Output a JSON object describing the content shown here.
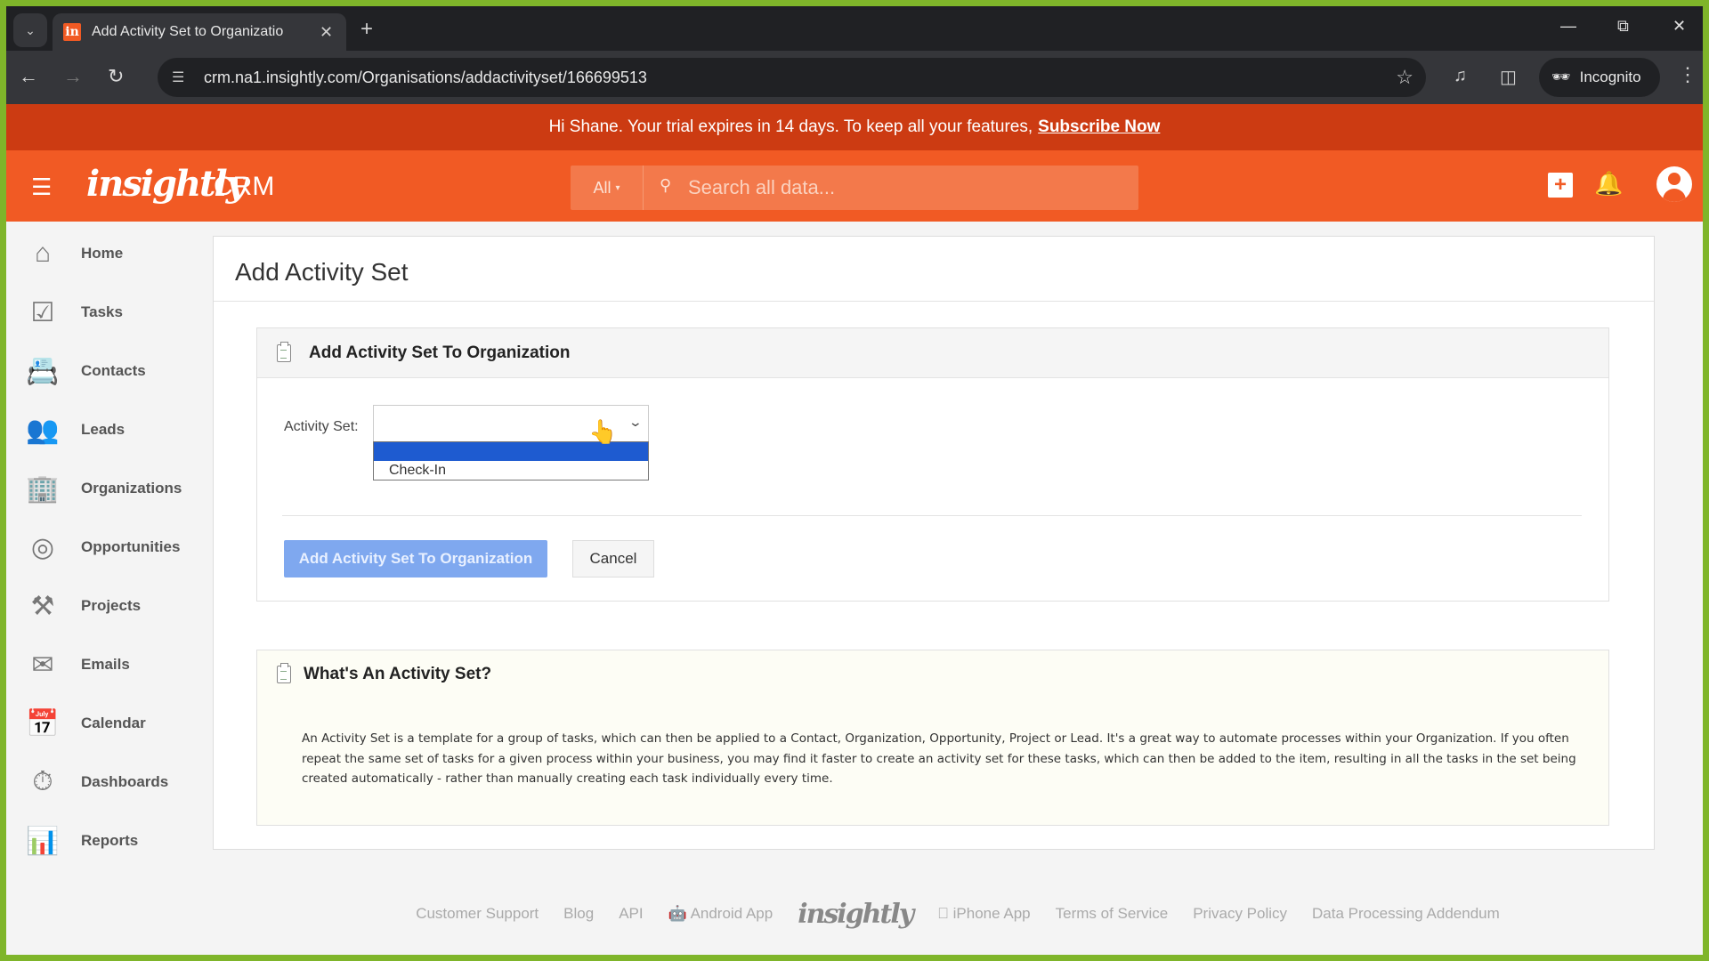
{
  "browser": {
    "tab_title": "Add Activity Set to Organizatio",
    "tab_favicon": "in",
    "url": "crm.na1.insightly.com/Organisations/addactivityset/166699513",
    "incognito_label": "Incognito"
  },
  "banner": {
    "text": "Hi Shane. Your trial expires in 14 days. To keep all your features,",
    "link": "Subscribe Now"
  },
  "header": {
    "logo": "insightly",
    "product": "CRM",
    "search_scope": "All",
    "search_placeholder": "Search all data..."
  },
  "sidebar": {
    "items": [
      {
        "label": "Home",
        "icon": "home-icon"
      },
      {
        "label": "Tasks",
        "icon": "tasks-icon"
      },
      {
        "label": "Contacts",
        "icon": "contacts-icon"
      },
      {
        "label": "Leads",
        "icon": "leads-icon"
      },
      {
        "label": "Organizations",
        "icon": "organizations-icon"
      },
      {
        "label": "Opportunities",
        "icon": "opportunities-icon"
      },
      {
        "label": "Projects",
        "icon": "projects-icon"
      },
      {
        "label": "Emails",
        "icon": "emails-icon"
      },
      {
        "label": "Calendar",
        "icon": "calendar-icon"
      },
      {
        "label": "Dashboards",
        "icon": "dashboards-icon"
      },
      {
        "label": "Reports",
        "icon": "reports-icon"
      }
    ]
  },
  "main": {
    "page_title": "Add Activity Set",
    "form": {
      "heading": "Add Activity Set To Organization",
      "field_label": "Activity Set:",
      "selected_value": "",
      "options": [
        "",
        "Check-In"
      ],
      "submit_label": "Add Activity Set To Organization",
      "cancel_label": "Cancel"
    },
    "help": {
      "heading": "What's An Activity Set?",
      "body": "An Activity Set is a template for a group of tasks, which can then be applied to a Contact, Organization, Opportunity, Project or Lead. It's a great way to automate processes within your Organization. If you often repeat the same set of tasks for a given process within your business, you may find it faster to create an activity set for these tasks, which can then be added to the item, resulting in all the tasks in the set being created automatically - rather than manually creating each task individually every time."
    }
  },
  "footer": {
    "links": [
      "Customer Support",
      "Blog",
      "API",
      "Android App",
      "iPhone App",
      "Terms of Service",
      "Privacy Policy",
      "Data Processing Addendum"
    ],
    "logo": "insightly"
  },
  "colors": {
    "brand": "#f15a24",
    "banner": "#cc3b12",
    "primary_button": "#7fa8ef",
    "dropdown_highlight": "#1e5bd0"
  }
}
